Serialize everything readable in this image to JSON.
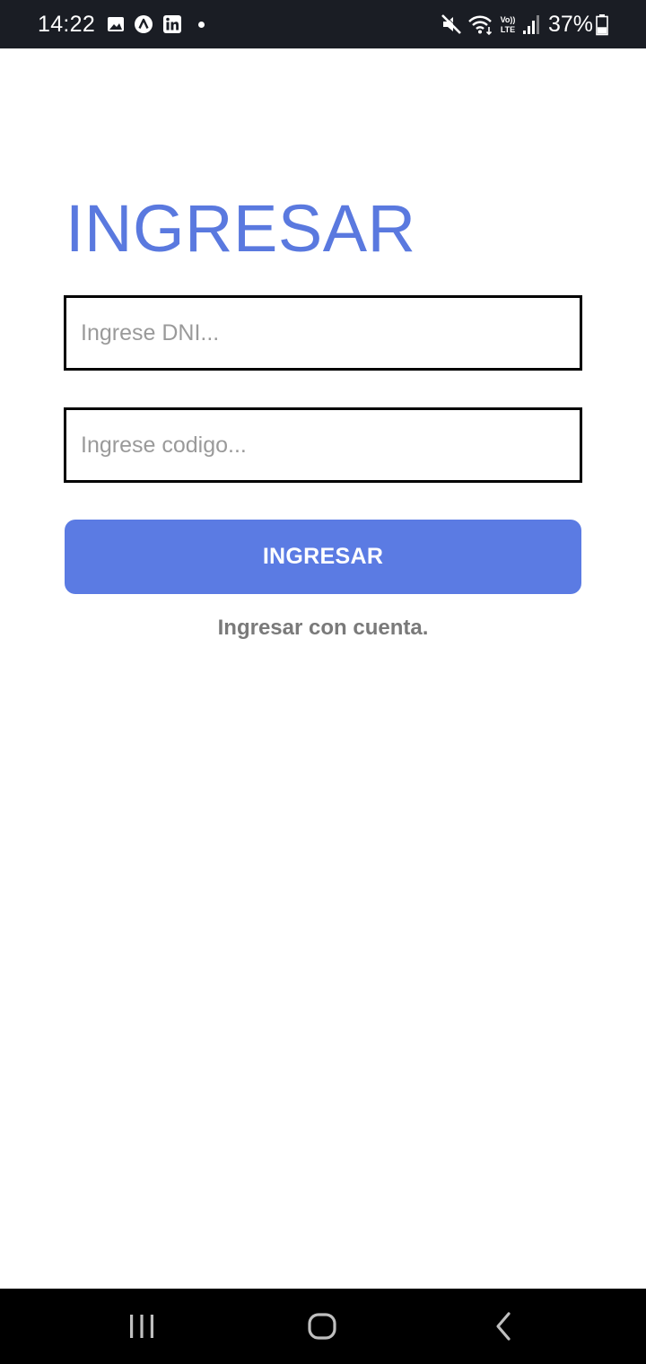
{
  "status_bar": {
    "time": "14:22",
    "notification_icons": [
      "gallery-icon",
      "app-a-icon",
      "linkedin-icon",
      "dot-icon"
    ],
    "system_icons": [
      "mute-icon",
      "wifi-icon",
      "volte-lte-icon",
      "signal-icon",
      "battery-icon"
    ],
    "volte_label": "Vo)) LTE",
    "battery_percent": "37%",
    "battery_level": 0.37,
    "background_color": "#1a1d24"
  },
  "login": {
    "title": "INGRESAR",
    "dni_placeholder": "Ingrese DNI...",
    "dni_value": "",
    "code_placeholder": "Ingrese codigo...",
    "code_value": "",
    "submit_label": "INGRESAR",
    "account_link": "Ingresar con cuenta."
  },
  "colors": {
    "accent": "#5b7be3",
    "title": "#5a79df",
    "link": "#7a7a7a",
    "input_border": "#000000"
  },
  "nav_bar": {
    "buttons": [
      "recents-icon",
      "home-icon",
      "back-icon"
    ]
  }
}
